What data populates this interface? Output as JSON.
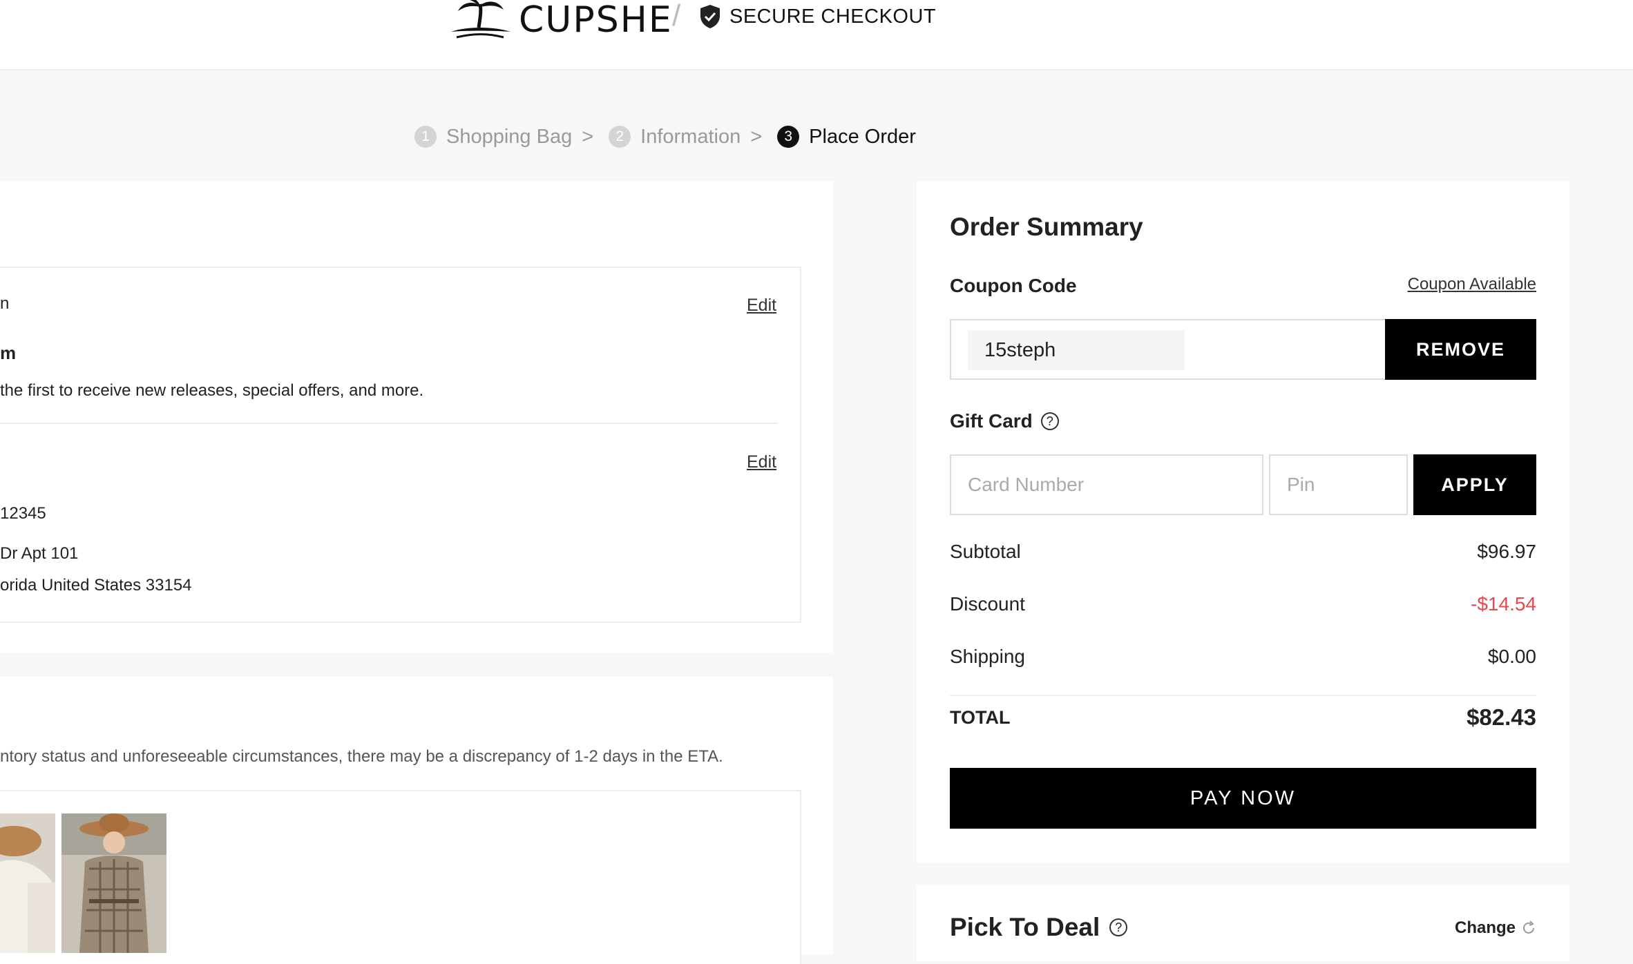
{
  "header": {
    "brand": "CUPSHE",
    "separator": "/",
    "secure_label": "SECURE CHECKOUT"
  },
  "steps": [
    {
      "num": "1",
      "label": "Shopping Bag",
      "arrow": ">"
    },
    {
      "num": "2",
      "label": "Information",
      "arrow": ">"
    },
    {
      "num": "3",
      "label": "Place Order",
      "arrow": ""
    }
  ],
  "contact": {
    "line1": "n",
    "line2": "m",
    "line3": "the first to receive new releases, special offers, and more.",
    "edit_label": "Edit"
  },
  "shipping_address": {
    "edit_label": "Edit",
    "line1": "12345",
    "line2": " Dr Apt 101",
    "line3": "orida United States 33154"
  },
  "delivery": {
    "note": "ntory status and unforeseeable circumstances, there may be a discrepancy of 1-2 days in the ETA."
  },
  "summary": {
    "title": "Order Summary",
    "coupon_label": "Coupon Code",
    "coupon_link": "Coupon Available",
    "coupon_value": "15steph",
    "remove_label": "REMOVE",
    "gift_label": "Gift Card",
    "gift_help": "?",
    "card_placeholder": "Card Number",
    "pin_placeholder": "Pin",
    "apply_label": "APPLY",
    "subtotal_label": "Subtotal",
    "subtotal_value": "$96.97",
    "discount_label": "Discount",
    "discount_value": "-$14.54",
    "shipping_label": "Shipping",
    "shipping_value": "$0.00",
    "total_label": "TOTAL",
    "total_value": "$82.43",
    "pay_label": "PAY NOW"
  },
  "pick_deal": {
    "title": "Pick To Deal",
    "help": "?",
    "change_label": "Change"
  },
  "colors": {
    "discount": "#e5484d",
    "button": "#000000",
    "background": "#f7f7f7"
  }
}
